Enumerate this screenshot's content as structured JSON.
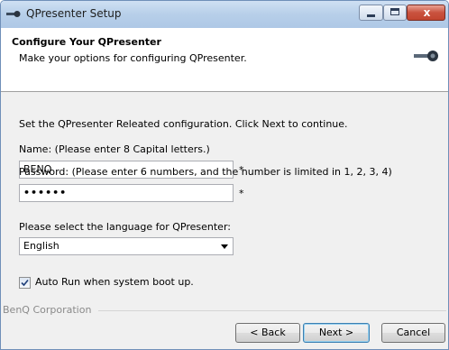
{
  "window": {
    "title": "QPresenter Setup",
    "close_glyph": "x"
  },
  "header": {
    "title": "Configure Your QPresenter",
    "subtitle": "Make your options for configuring QPresenter.",
    "logo_icon": "projector-icon"
  },
  "form": {
    "intro": "Set the QPresenter Releated configuration. Click Next to continue.",
    "name_label": "Name: (Please enter 8 Capital letters.)",
    "name_value": "BENQ",
    "name_required": "*",
    "password_label": "Password: (Please enter 6 numbers, and the number is limited in 1, 2, 3, 4)",
    "password_value": "••••••",
    "password_required": "*",
    "language_label": "Please select the language for QPresenter:",
    "language_value": "English",
    "autorun_label": "Auto Run when system boot up.",
    "autorun_checked": true
  },
  "footer": {
    "company": "BenQ Corporation",
    "back_label": "< Back",
    "next_label": "Next >",
    "cancel_label": "Cancel"
  }
}
